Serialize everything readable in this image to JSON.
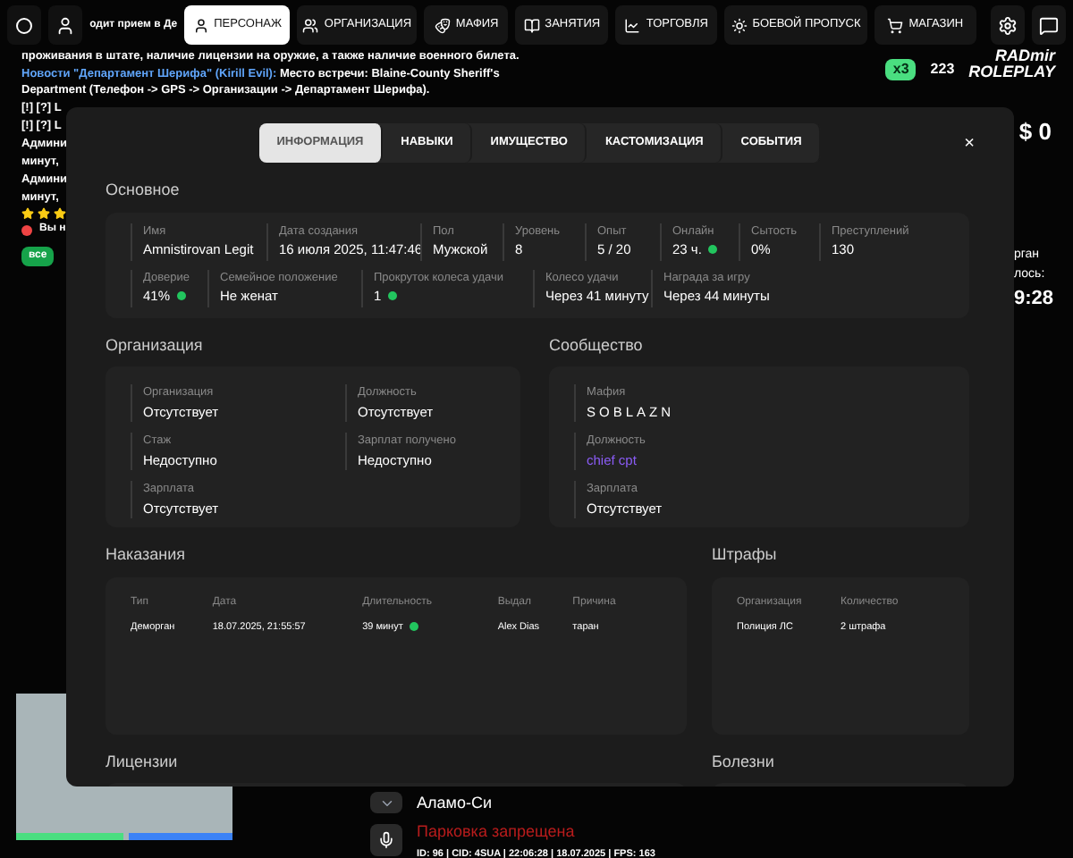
{
  "nav": {
    "items": [
      {
        "label": "ПЕРСОНАЖ",
        "selected": true
      },
      {
        "label": "ОРГАНИЗАЦИЯ",
        "selected": false
      },
      {
        "label": "МАФИЯ",
        "selected": false
      },
      {
        "label": "ЗАНЯТИЯ",
        "selected": false
      },
      {
        "label": "ТОРГОВЛЯ",
        "selected": false
      },
      {
        "label": "БОЕВОЙ ПРОПУСК",
        "selected": false
      },
      {
        "label": "МАГАЗИН",
        "selected": false
      }
    ]
  },
  "chat": {
    "lines": [
      {
        "kind": "plain",
        "text": "проживания в штате, наличие лицензии на оружие, а также наличие военного билета."
      },
      {
        "kind": "news",
        "source": "Новости \"Департамент Шерифа\" (Kirill Evil):",
        "text": "Место встречи: Blaine-County Sheriff's Department (Телефон -> GPS -> Организации -> Департамент Шерифа)."
      },
      {
        "kind": "plain",
        "text": "[!] [?] L"
      },
      {
        "kind": "plain",
        "text": "[!] [?] L"
      },
      {
        "kind": "plain",
        "text": "Админи"
      },
      {
        "kind": "plain",
        "text": "минут,"
      },
      {
        "kind": "plain",
        "text": "Админи"
      },
      {
        "kind": "plain",
        "text": "минут,"
      }
    ],
    "top_line": "одит прием в Де",
    "stars": 3,
    "alert": "Вы н",
    "badge": "все"
  },
  "hud": {
    "logo_top": "RADmir",
    "logo_bottom": "ROLEPLAY",
    "bonus": "x3",
    "online": "223",
    "money": "$ 0",
    "side_texts": [
      "рган",
      "лось:",
      "9:28"
    ],
    "location": "Аламо-Си",
    "zone_warning": "Парковка запрещена",
    "status_line": "ID: 96 | CID: 4SUA | 22:06:28 | 18.07.2025 | FPS: 163"
  },
  "modal": {
    "tabs": [
      {
        "label": "ИНФОРМАЦИЯ",
        "selected": true
      },
      {
        "label": "НАВЫКИ",
        "selected": false
      },
      {
        "label": "ИМУЩЕСТВО",
        "selected": false
      },
      {
        "label": "КАСТОМИЗАЦИЯ",
        "selected": false
      },
      {
        "label": "СОБЫТИЯ",
        "selected": false
      }
    ],
    "close": "×",
    "basic": {
      "title": "Основное",
      "top_fields": [
        {
          "label": "Имя",
          "value": "Amnistirovan Legit",
          "dot": false
        },
        {
          "label": "Дата создания",
          "value": "16 июля 2025, 11:47:46",
          "dot": false
        },
        {
          "label": "Пол",
          "value": "Мужской",
          "dot": false
        },
        {
          "label": "Уровень",
          "value": "8",
          "dot": false
        },
        {
          "label": "Опыт",
          "value": "5 / 20",
          "dot": false
        },
        {
          "label": "Онлайн",
          "value": "23 ч.",
          "dot": true
        },
        {
          "label": "Сытость",
          "value": "0%",
          "dot": false
        },
        {
          "label": "Преступлений",
          "value": "130",
          "dot": false
        }
      ],
      "bottom_fields": [
        {
          "label": "Доверие",
          "value": "41%",
          "dot": true
        },
        {
          "label": "Семейное положение",
          "value": "Не женат",
          "dot": false
        },
        {
          "label": "Прокруток колеса удачи",
          "value": "1",
          "dot": true
        },
        {
          "label": "Колесо удачи",
          "value": "Через 41 минуту",
          "dot": false
        },
        {
          "label": "Награда за игру",
          "value": "Через 44 минуты",
          "dot": false
        }
      ]
    },
    "organization": {
      "title": "Организация",
      "columns": [
        [
          {
            "label": "Организация",
            "value": "Отсутствует"
          },
          {
            "label": "Стаж",
            "value": "Недоступно"
          },
          {
            "label": "Зарплата",
            "value": "Отсутствует"
          }
        ],
        [
          {
            "label": "Должность",
            "value": "Отсутствует"
          },
          {
            "label": "Зарплат получено",
            "value": "Недоступно"
          }
        ]
      ]
    },
    "community": {
      "title": "Сообщество",
      "fields": [
        {
          "label": "Мафия",
          "value": "SOBLAZN",
          "kind": "spaced"
        },
        {
          "label": "Должность",
          "value": "chief cpt",
          "kind": "accent"
        },
        {
          "label": "Зарплата",
          "value": "Отсутствует",
          "kind": "plain"
        }
      ]
    },
    "punishments": {
      "title": "Наказания",
      "columns": [
        "Тип",
        "Дата",
        "Длительность",
        "Выдал",
        "Причина"
      ],
      "rows": [
        {
          "cells": [
            "Деморган",
            "18.07.2025, 21:55:57",
            "39 минут",
            "Alex Dias",
            "таран"
          ],
          "active": true
        }
      ]
    },
    "fines": {
      "title": "Штрафы",
      "columns": [
        "Организация",
        "Количество"
      ],
      "rows": [
        [
          "Полиция ЛС",
          "2 штрафа"
        ]
      ]
    },
    "licenses": {
      "title": "Лицензии"
    },
    "diseases": {
      "title": "Болезни"
    }
  }
}
